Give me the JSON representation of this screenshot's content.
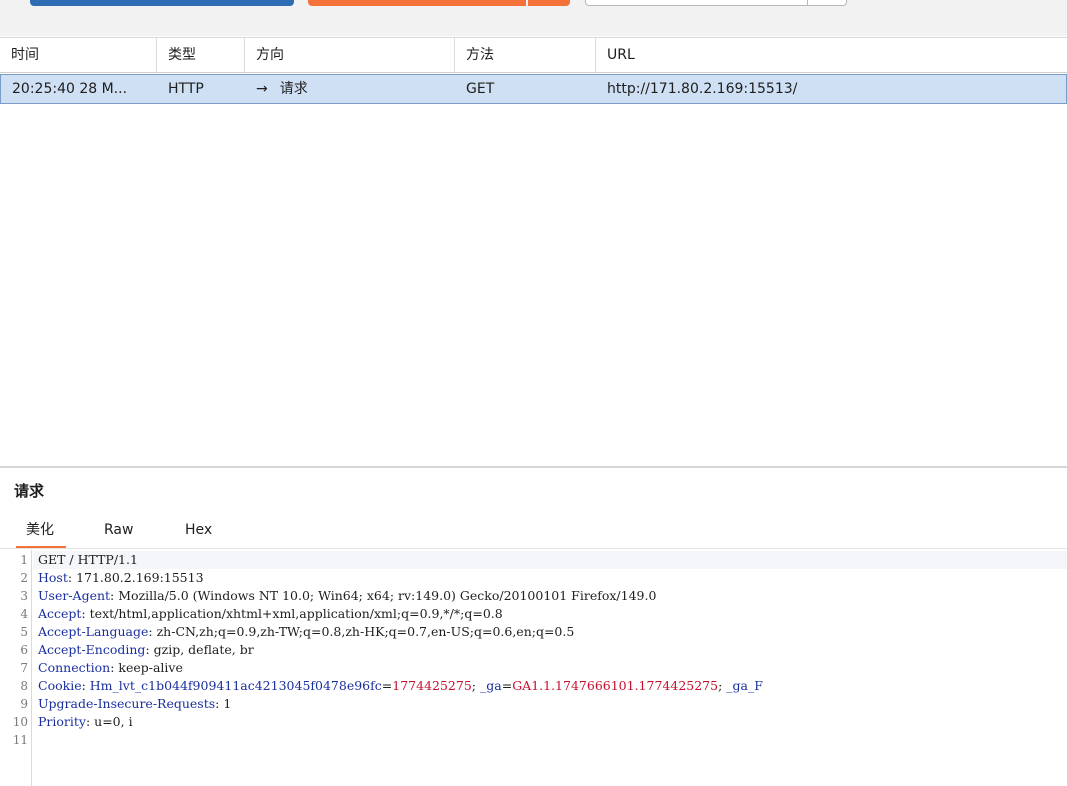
{
  "table": {
    "columns": [
      "时间",
      "类型",
      "方向",
      "方法",
      "URL"
    ],
    "rows": [
      {
        "time": "20:25:40 28 M...",
        "type": "HTTP",
        "direction_arrow": "→",
        "direction": "请求",
        "method": "GET",
        "url": "http://171.80.2.169:15513/"
      }
    ]
  },
  "panel": {
    "title": "请求",
    "tabs": [
      "美化",
      "Raw",
      "Hex"
    ],
    "active_tab": "美化"
  },
  "request": {
    "line1": "GET / HTTP/1.1",
    "headers": [
      {
        "name": "Host",
        "value": " 171.80.2.169:15513"
      },
      {
        "name": "User-Agent",
        "value": " Mozilla/5.0 (Windows NT 10.0; Win64; x64; rv:149.0) Gecko/20100101 Firefox/149.0"
      },
      {
        "name": "Accept",
        "value": " text/html,application/xhtml+xml,application/xml;q=0.9,*/*;q=0.8"
      },
      {
        "name": "Accept-Language",
        "value": " zh-CN,zh;q=0.9,zh-TW;q=0.8,zh-HK;q=0.7,en-US;q=0.6,en;q=0.5"
      },
      {
        "name": "Accept-Encoding",
        "value": " gzip, deflate, br"
      },
      {
        "name": "Connection",
        "value": " keep-alive"
      }
    ],
    "cookie": {
      "name": "Cookie",
      "c1_name": "Hm_lvt_c1b044f909411ac4213045f0478e96fc",
      "c1_value": "1774425275",
      "c2_name": "_ga",
      "c2_value": "GA1.1.1747666101.1774425275",
      "c3_name": "_ga_F"
    },
    "headers_after": [
      {
        "name": "Upgrade-Insecure-Requests",
        "value": " 1"
      },
      {
        "name": "Priority",
        "value": " u=0, i"
      }
    ],
    "line_numbers": [
      "1",
      "2",
      "3",
      "4",
      "5",
      "6",
      "7",
      "8",
      "9",
      "10",
      "11"
    ]
  },
  "colors": {
    "accent_orange": "#f5713a",
    "accent_blue": "#2e6db4",
    "selection": "#cfe0f5",
    "header_name": "#1a2fa0",
    "cookie_value": "#c8102e"
  }
}
